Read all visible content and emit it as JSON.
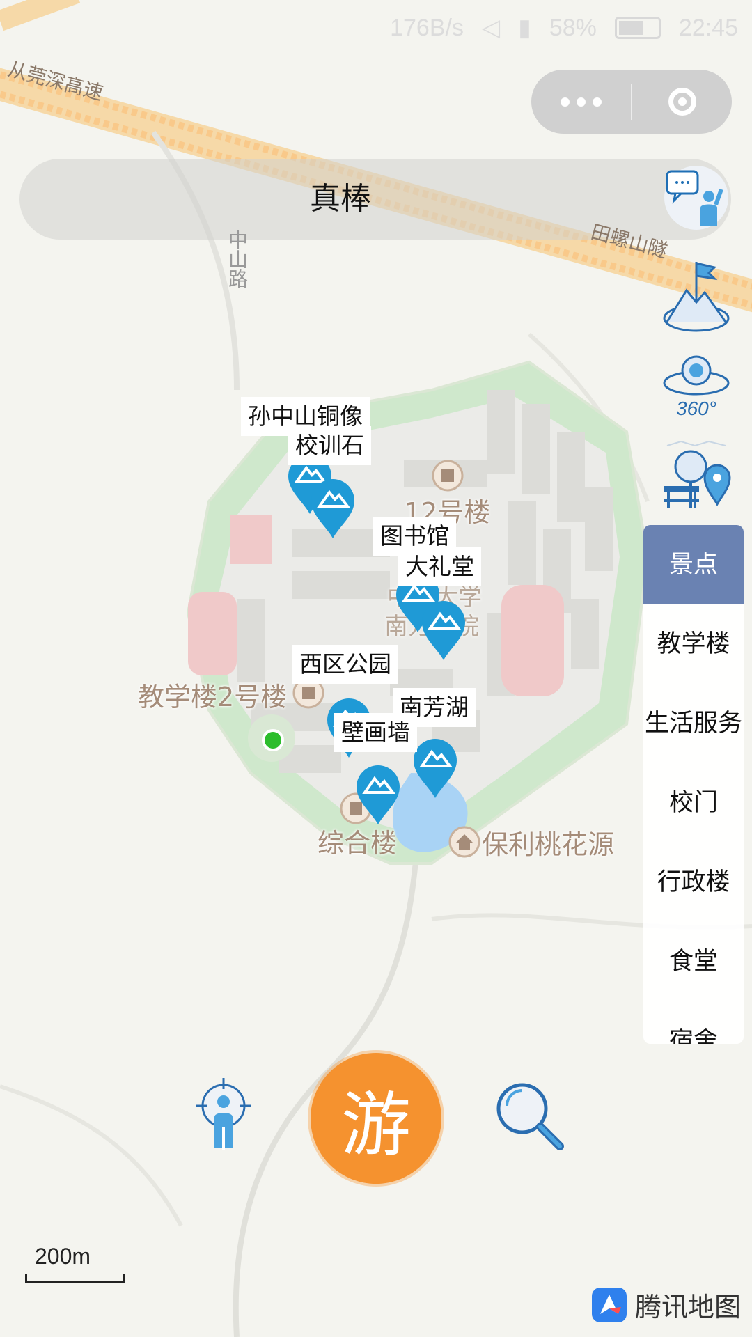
{
  "status_bar": {
    "net_speed": "176B/s",
    "battery": "58%",
    "time": "22:45"
  },
  "title": "真棒",
  "map": {
    "roads": [
      "从莞深高速",
      "中山路",
      "田螺山隧"
    ],
    "places": [
      "12号楼",
      "教学楼2号楼",
      "综合楼",
      "保利桃花源",
      "中山大学",
      "南方学院"
    ],
    "spot_labels": [
      "孙中山铜像",
      "校训石",
      "图书馆",
      "大礼堂",
      "西区公园",
      "南芳湖",
      "壁画墙"
    ],
    "scale": "200m",
    "brand": "腾讯地图"
  },
  "categories": [
    {
      "label": "景点",
      "active": true
    },
    {
      "label": "教学楼",
      "active": false
    },
    {
      "label": "生活服务",
      "active": false
    },
    {
      "label": "校门",
      "active": false
    },
    {
      "label": "行政楼",
      "active": false
    },
    {
      "label": "食堂",
      "active": false
    },
    {
      "label": "宿舍",
      "active": false
    }
  ],
  "side_icons": [
    "chat-guide-icon",
    "flag-mountain-icon",
    "panorama-360-icon",
    "park-location-icon"
  ],
  "go_button": "游",
  "colors": {
    "accent_blue": "#1f9ad6",
    "active_category": "#6a82b2",
    "go_orange": "#f5922f",
    "campus_green": "#cfe8cc"
  }
}
